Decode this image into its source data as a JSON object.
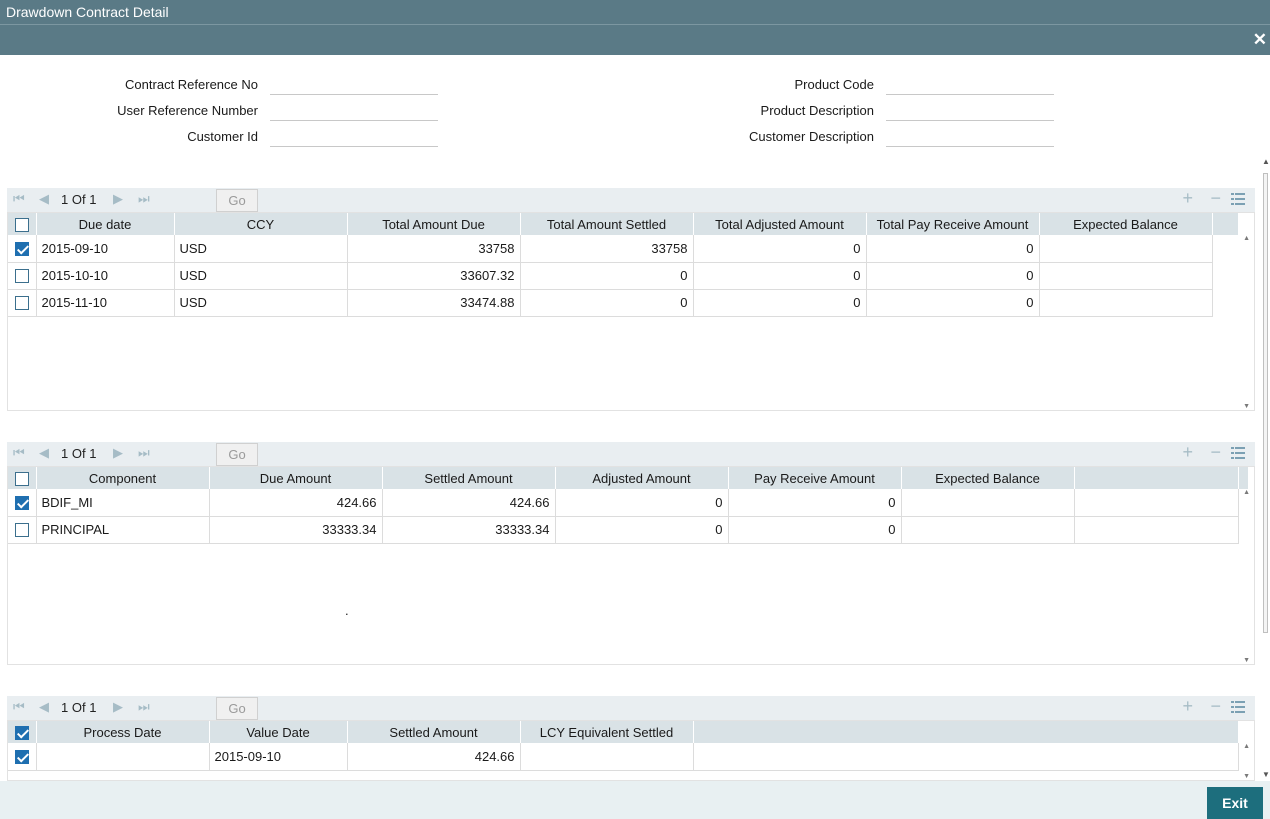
{
  "window": {
    "title": "Drawdown Contract Detail",
    "close_glyph": "✕"
  },
  "form": {
    "contract_ref_label": "Contract Reference No",
    "contract_ref_value": "",
    "user_ref_label": "User Reference Number",
    "user_ref_value": "",
    "customer_id_label": "Customer Id",
    "customer_id_value": "",
    "product_code_label": "Product Code",
    "product_code_value": "",
    "product_desc_label": "Product Description",
    "product_desc_value": "",
    "customer_desc_label": "Customer Description",
    "customer_desc_value": ""
  },
  "grid1": {
    "page": "1",
    "of_label": "Of",
    "total": "1",
    "go_label": "Go",
    "headers": [
      "Due date",
      "CCY",
      "Total Amount Due",
      "Total Amount Settled",
      "Total Adjusted Amount",
      "Total Pay Receive Amount",
      "Expected Balance"
    ],
    "rows": [
      {
        "checked": true,
        "cells": [
          "2015-09-10",
          "USD",
          "33758",
          "33758",
          "0",
          "0",
          ""
        ]
      },
      {
        "checked": false,
        "cells": [
          "2015-10-10",
          "USD",
          "33607.32",
          "0",
          "0",
          "0",
          ""
        ]
      },
      {
        "checked": false,
        "cells": [
          "2015-11-10",
          "USD",
          "33474.88",
          "0",
          "0",
          "0",
          ""
        ]
      }
    ]
  },
  "grid2": {
    "page": "1",
    "of_label": "Of",
    "total": "1",
    "go_label": "Go",
    "headers": [
      "Component",
      "Due Amount",
      "Settled Amount",
      "Adjusted Amount",
      "Pay Receive Amount",
      "Expected Balance"
    ],
    "rows": [
      {
        "checked": true,
        "cells": [
          "BDIF_MI",
          "424.66",
          "424.66",
          "0",
          "0",
          ""
        ]
      },
      {
        "checked": false,
        "cells": [
          "PRINCIPAL",
          "33333.34",
          "33333.34",
          "0",
          "0",
          ""
        ]
      }
    ],
    "stray_mark": "."
  },
  "grid3": {
    "page": "1",
    "of_label": "Of",
    "total": "1",
    "go_label": "Go",
    "header_checked": true,
    "headers": [
      "Process Date",
      "Value Date",
      "Settled Amount",
      "LCY Equivalent Settled"
    ],
    "rows": [
      {
        "checked": true,
        "cells": [
          "",
          "2015-09-10",
          "424.66",
          ""
        ]
      }
    ]
  },
  "footer": {
    "exit_label": "Exit"
  },
  "colors": {
    "header_bar": "#5a7a86",
    "grid_header": "#d9e2e6",
    "exit_button": "#1d6e7d",
    "checkbox_on": "#1f6fb0"
  }
}
